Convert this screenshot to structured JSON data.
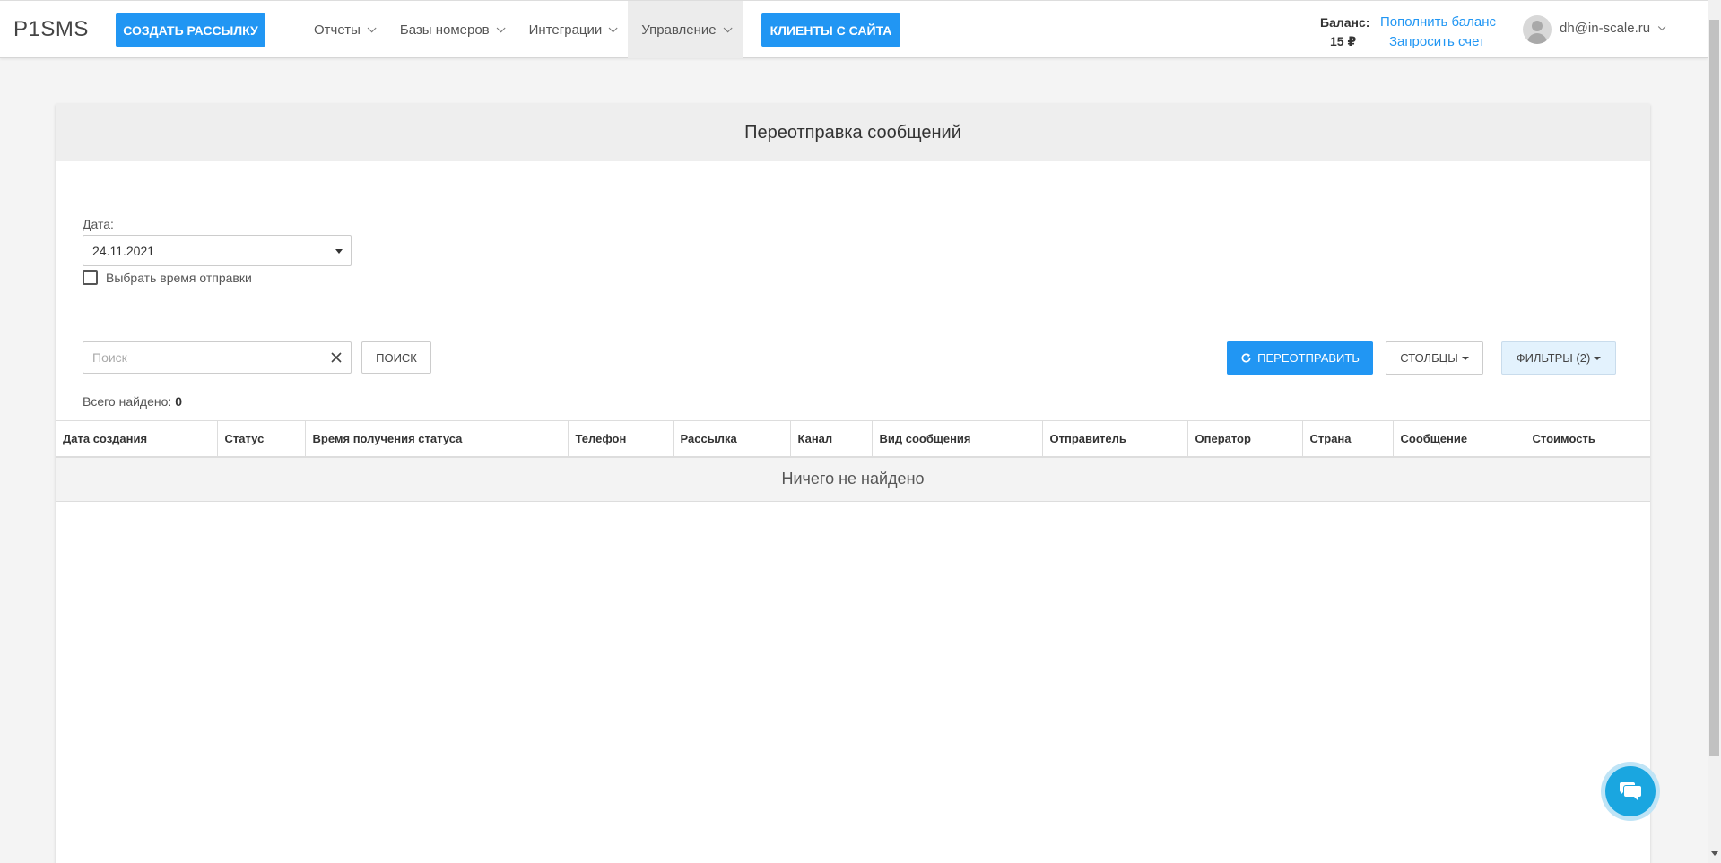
{
  "header": {
    "logo": "P1SMS",
    "create_button": "Создать рассылку",
    "nav": [
      {
        "label": "Отчеты"
      },
      {
        "label": "Базы номеров"
      },
      {
        "label": "Интеграции"
      },
      {
        "label": "Управление"
      }
    ],
    "clients_button": "Клиенты с сайта",
    "balance_label": "Баланс:",
    "balance_value": "15 ₽",
    "topup_link": "Пополнить баланс",
    "invoice_link": "Запросить счет",
    "user_email": "dh@in-scale.ru"
  },
  "page": {
    "title": "Переотправка сообщений",
    "date_label": "Дата:",
    "date_value": "24.11.2021",
    "choose_time_label": "Выбрать время отправки",
    "search_placeholder": "Поиск",
    "search_button": "Поиск",
    "resend_button": "Переотправить",
    "columns_button": "Столбцы",
    "filters_button": "Фильтры (2)",
    "total_label": "Всего найдено:",
    "total_count": "0",
    "empty_message": "Ничего не найдено"
  },
  "table": {
    "columns": [
      "Дата создания",
      "Статус",
      "Время получения статуса",
      "Телефон",
      "Рассылка",
      "Канал",
      "Вид сообщения",
      "Отправитель",
      "Оператор",
      "Страна",
      "Сообщение",
      "Стоимость"
    ]
  },
  "colors": {
    "accent": "#2196f3",
    "chat": "#1aa6e0"
  }
}
